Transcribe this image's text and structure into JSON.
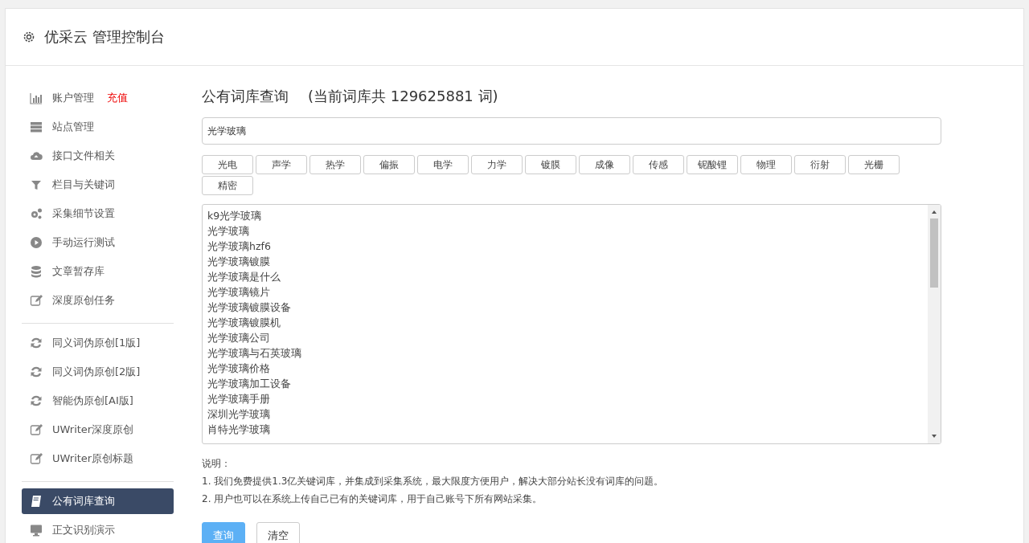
{
  "header": {
    "title": "优采云 管理控制台"
  },
  "sidebar": {
    "groups": [
      [
        {
          "label": "账户管理",
          "badge": "充值",
          "kind": "chart",
          "selected": false
        },
        {
          "label": "站点管理",
          "kind": "server",
          "selected": false
        },
        {
          "label": "接口文件相关",
          "kind": "cloud",
          "selected": false
        },
        {
          "label": "栏目与关键词",
          "kind": "filter",
          "selected": false
        },
        {
          "label": "采集细节设置",
          "kind": "gears",
          "selected": false
        },
        {
          "label": "手动运行测试",
          "kind": "play",
          "selected": false
        },
        {
          "label": "文章暂存库",
          "kind": "database",
          "selected": false
        },
        {
          "label": "深度原创任务",
          "kind": "edit",
          "selected": false
        }
      ],
      [
        {
          "label": "同义词伪原创[1版]",
          "kind": "refresh",
          "selected": false
        },
        {
          "label": "同义词伪原创[2版]",
          "kind": "refresh",
          "selected": false
        },
        {
          "label": "智能伪原创[AI版]",
          "kind": "refresh",
          "selected": false
        },
        {
          "label": "UWriter深度原创",
          "kind": "edit",
          "selected": false
        },
        {
          "label": "UWriter原创标题",
          "kind": "edit",
          "selected": false
        }
      ],
      [
        {
          "label": "公有词库查询",
          "kind": "book",
          "selected": true
        },
        {
          "label": "正文识别演示",
          "kind": "monitor",
          "selected": false
        }
      ]
    ]
  },
  "main": {
    "title": "公有词库查询",
    "count_note": "(当前词库共 129625881 词)",
    "search": {
      "value": "光学玻璃"
    },
    "tags": [
      "光电",
      "声学",
      "热学",
      "偏振",
      "电学",
      "力学",
      "镀膜",
      "成像",
      "传感",
      "铌酸锂",
      "物理",
      "衍射",
      "光栅",
      "精密"
    ],
    "results": [
      "k9光学玻璃",
      "光学玻璃",
      "光学玻璃hzf6",
      "光学玻璃镀膜",
      "光学玻璃是什么",
      "光学玻璃镜片",
      "光学玻璃镀膜设备",
      "光学玻璃镀膜机",
      "光学玻璃公司",
      "光学玻璃与石英玻璃",
      "光学玻璃价格",
      "光学玻璃加工设备",
      "光学玻璃手册",
      "深圳光学玻璃",
      "肖特光学玻璃"
    ],
    "notes_title": "说明：",
    "notes": [
      "1. 我们免费提供1.3亿关键词库，并集成到采集系统，最大限度方便用户，解决大部分站长没有词库的问题。",
      "2. 用户也可以在系统上传自己已有的关键词库，用于自己账号下所有网站采集。"
    ],
    "buttons": [
      {
        "label": "查询",
        "kind": "primary"
      },
      {
        "label": "清空",
        "kind": "default"
      }
    ]
  }
}
